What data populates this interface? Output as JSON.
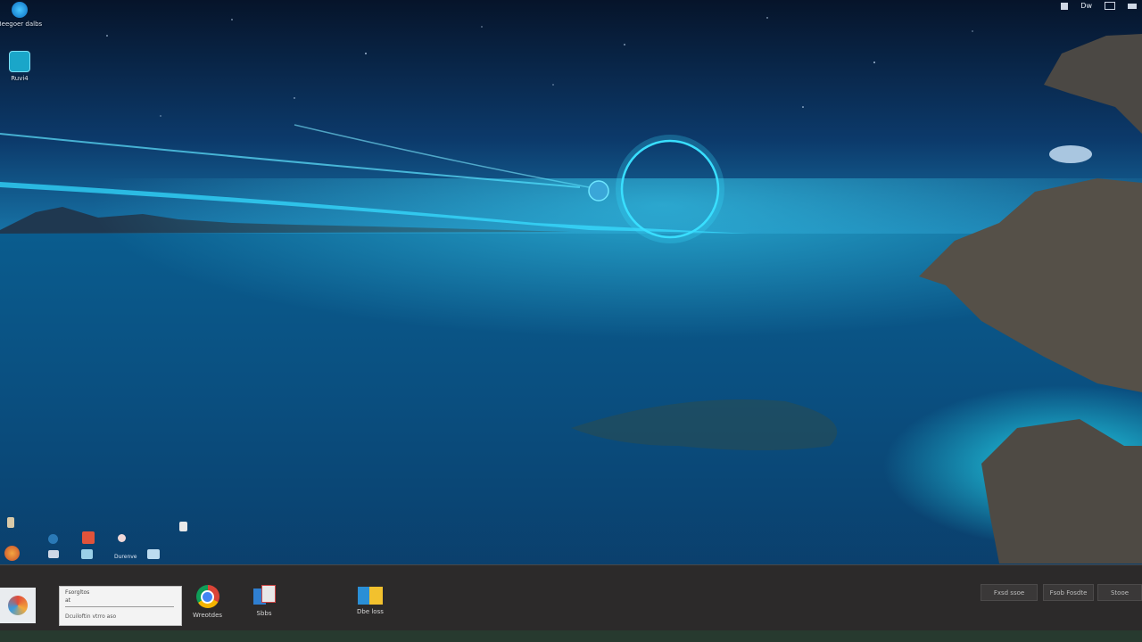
{
  "desktop": {
    "icons": [
      {
        "name": "edge-icon",
        "label": "Beegoer dalbs"
      },
      {
        "name": "app-icon",
        "label": "Ruvi4"
      }
    ],
    "cluster_label": "Durenve"
  },
  "top_tray": {
    "a": "Dw"
  },
  "taskbar": {
    "window_title": "Fsorgltos",
    "window_line2": "at",
    "window_line3": "Dcuiloftin vtrro aso",
    "chrome_label": "Wreotdes",
    "files_label": "Sbbs",
    "explorer_label": "Dbe loss",
    "tray_buttons": [
      "Fxsd ssoe",
      "Fsob Fosdte",
      "Stooe"
    ]
  },
  "colors": {
    "accent": "#19c9e6",
    "taskbar": "#2c2a2a"
  }
}
